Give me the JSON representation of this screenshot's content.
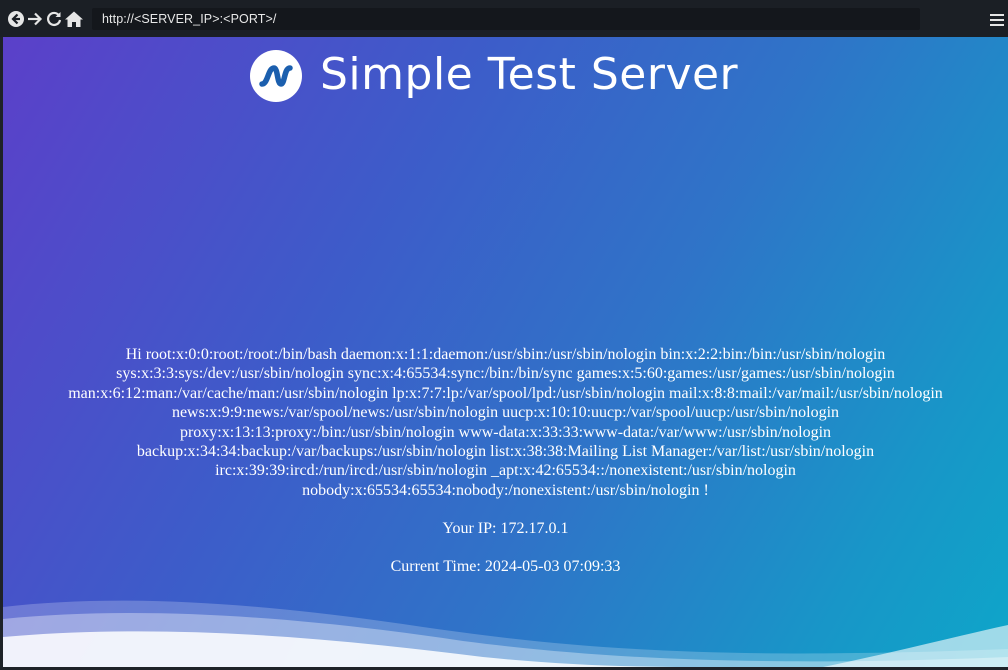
{
  "browser": {
    "address": "http://<SERVER_IP>:<PORT>/",
    "icons": {
      "back": "back-icon",
      "forward": "forward-icon",
      "reload": "reload-icon",
      "home": "home-icon",
      "menu": "menu-icon"
    }
  },
  "page": {
    "title": "Simple Test Server",
    "greeting_lines": [
      "Hi root:x:0:0:root:/root:/bin/bash daemon:x:1:1:daemon:/usr/sbin:/usr/sbin/nologin bin:x:2:2:bin:/bin:/usr/sbin/nologin",
      "sys:x:3:3:sys:/dev:/usr/sbin/nologin sync:x:4:65534:sync:/bin:/bin/sync games:x:5:60:games:/usr/games:/usr/sbin/nologin",
      "man:x:6:12:man:/var/cache/man:/usr/sbin/nologin lp:x:7:7:lp:/var/spool/lpd:/usr/sbin/nologin mail:x:8:8:mail:/var/mail:/usr/sbin/nologin",
      "news:x:9:9:news:/var/spool/news:/usr/sbin/nologin uucp:x:10:10:uucp:/var/spool/uucp:/usr/sbin/nologin",
      "proxy:x:13:13:proxy:/bin:/usr/sbin/nologin www-data:x:33:33:www-data:/var/www:/usr/sbin/nologin",
      "backup:x:34:34:backup:/var/backups:/usr/sbin/nologin list:x:38:38:Mailing List Manager:/var/list:/usr/sbin/nologin",
      "irc:x:39:39:ircd:/run/ircd:/usr/sbin/nologin _apt:x:42:65534::/nonexistent:/usr/sbin/nologin",
      "nobody:x:65534:65534:nobody:/nonexistent:/usr/sbin/nologin !"
    ],
    "ip_text": "Your IP: 172.17.0.1",
    "time_text": "Current Time: 2024-05-03 07:09:33"
  },
  "colors": {
    "gradient_start": "#5b40c9",
    "gradient_end": "#0ea6c9",
    "toolbar": "#1b1f25",
    "text": "#ffffff"
  }
}
